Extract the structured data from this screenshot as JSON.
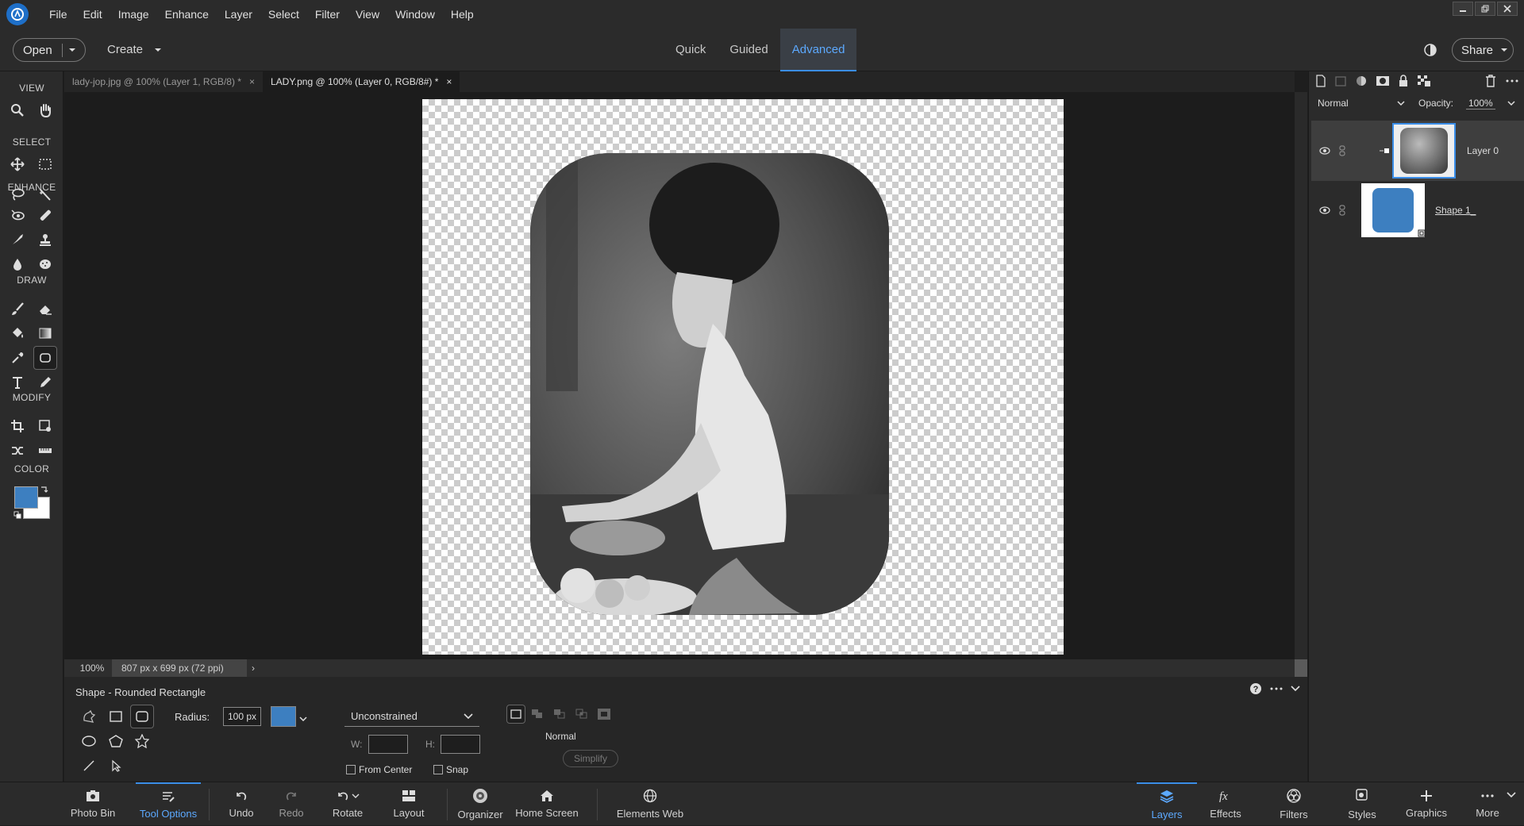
{
  "menubar": {
    "items": [
      "File",
      "Edit",
      "Image",
      "Enhance",
      "Layer",
      "Select",
      "Filter",
      "View",
      "Window",
      "Help"
    ]
  },
  "topbar": {
    "open_label": "Open",
    "create_label": "Create",
    "modes": [
      "Quick",
      "Guided",
      "Advanced"
    ],
    "active_mode": "Advanced",
    "share_label": "Share"
  },
  "toolbox": {
    "sections": {
      "view": "VIEW",
      "select": "SELECT",
      "enhance": "ENHANCE",
      "draw": "DRAW",
      "modify": "MODIFY",
      "color": "COLOR"
    },
    "foreground_color": "#3d7fc0",
    "background_color": "#ffffff"
  },
  "documents": {
    "tabs": [
      {
        "title": "lady-jop.jpg @ 100% (Layer 1, RGB/8) *",
        "close": "×"
      },
      {
        "title": "LADY.png @ 100% (Layer 0, RGB/8#) *",
        "close": "×"
      }
    ],
    "active_tab": 1
  },
  "status": {
    "zoom": "100%",
    "size": "807 px x 699 px (72 ppi)",
    "arrow": "›"
  },
  "tool_options": {
    "title": "Shape - Rounded Rectangle",
    "radius_label": "Radius:",
    "radius_value": "100 px",
    "fill_color": "#3d7fc0",
    "constraint": "Unconstrained",
    "w_label": "W:",
    "h_label": "H:",
    "from_center_label": "From Center",
    "snap_label": "Snap",
    "blend_mode": "Normal",
    "simplify_label": "Simplify"
  },
  "layers_panel": {
    "blend_mode": "Normal",
    "opacity_label": "Opacity:",
    "opacity_value": "100%",
    "layers": [
      {
        "name": "Layer 0",
        "selected": true
      },
      {
        "name": "Shape 1_",
        "selected": false
      }
    ]
  },
  "bottombar": {
    "left": [
      "Photo Bin",
      "Tool Options",
      "Undo",
      "Redo",
      "Rotate",
      "Layout",
      "Organizer",
      "Home Screen",
      "Elements Web"
    ],
    "right": [
      "Layers",
      "Effects",
      "Filters",
      "Styles",
      "Graphics",
      "More"
    ],
    "active_left": "Tool Options",
    "active_right": "Layers"
  }
}
